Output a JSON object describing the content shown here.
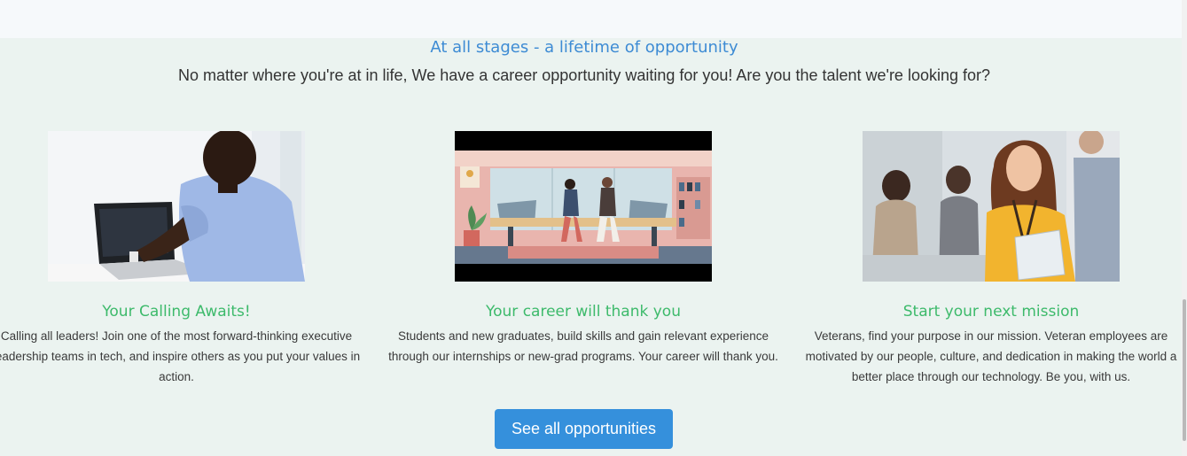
{
  "section": {
    "eyebrow": "At all stages - a lifetime of opportunity",
    "subtitle": "No matter where you're at in life, We have a career opportunity waiting for you! Are you the talent we're looking for?"
  },
  "cards": [
    {
      "image": "person-typing-laptop",
      "title": "Your Calling Awaits!",
      "body": "Calling all leaders! Join one of the most forward-thinking executive leadership teams in tech, and inspire others as you put your values in action."
    },
    {
      "image": "office-high-five-illustration",
      "title": "Your career will thank you",
      "body": "Students and new graduates, build skills and gain relevant experience through our internships or new-grad programs. Your career will thank you."
    },
    {
      "image": "smiling-woman-with-tablet",
      "title": "Start your next mission",
      "body": "Veterans, find your purpose in our mission. Veteran employees are motivated by our people, culture, and dedication in making the world a better place through our technology. Be you, with us."
    }
  ],
  "cta": {
    "label": "See all opportunities"
  },
  "colors": {
    "background": "#ebf3f0",
    "heading_blue": "#3d8bd4",
    "card_title_green": "#3dba6b",
    "button_blue": "#3590dc"
  }
}
